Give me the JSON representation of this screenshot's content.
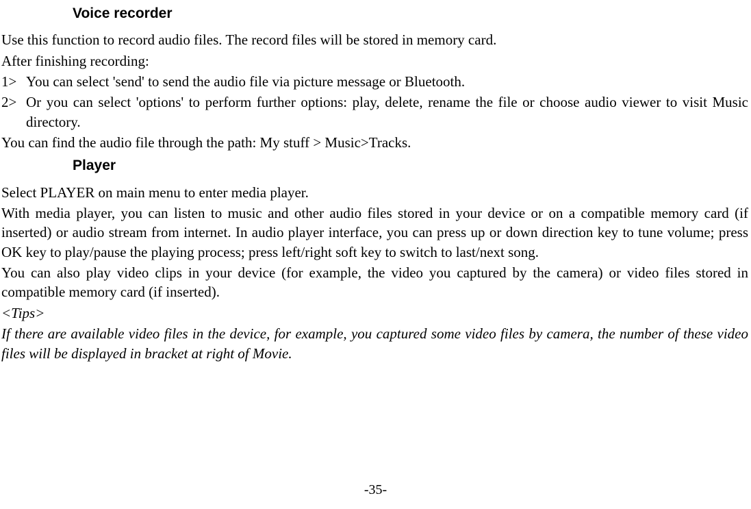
{
  "sections": {
    "voice_recorder": {
      "heading": "Voice recorder",
      "intro": "Use this function to record audio files. The record files will be stored in memory card.",
      "after": "After finishing recording:",
      "items": [
        {
          "marker": "1>",
          "text": "You can select 'send' to send the audio file via picture message or Bluetooth."
        },
        {
          "marker": "2>",
          "text": "Or you can select 'options' to perform further options: play, delete, rename the file or choose audio viewer to visit Music directory."
        }
      ],
      "path": "You can find the audio file through the path: My stuff > Music>Tracks."
    },
    "player": {
      "heading": "Player",
      "select": "Select PLAYER on main menu to enter media player.",
      "media": "With media player, you can listen to music and other audio files stored in your device or on a compatible memory card (if inserted) or audio stream from internet. In audio player interface, you can press up or down direction key to tune volume; press OK key to play/pause the playing process; press left/right soft key to switch to last/next song.",
      "video": "You can also play video clips in your device (for example, the video you captured by the camera) or video files stored in compatible memory card (if inserted).",
      "tips_label": "<Tips>",
      "tips_body": "If there are available video files in the device, for example, you captured some video files by camera, the number of these video files will be displayed in bracket at right of Movie."
    }
  },
  "page_number": "-35-"
}
